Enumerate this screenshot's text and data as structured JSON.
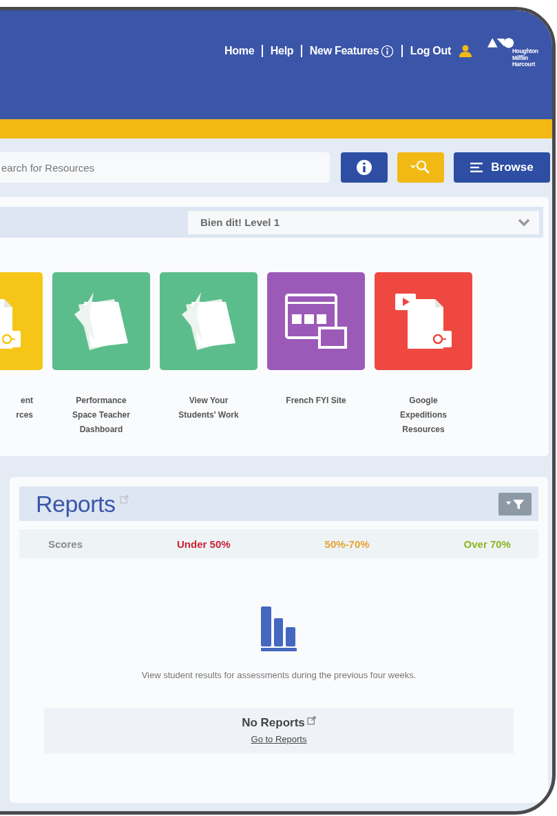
{
  "header": {
    "nav": [
      {
        "label": "Home",
        "kind": "plain"
      },
      {
        "label": "Help",
        "kind": "plain"
      },
      {
        "label": "New Features",
        "kind": "info"
      },
      {
        "label": "Log Out",
        "kind": "user"
      }
    ],
    "logo": {
      "lines": [
        "Houghton",
        "Mifflin",
        "Harcourt"
      ]
    }
  },
  "search": {
    "placeholder": "earch for Resources",
    "browse_label": "Browse"
  },
  "course_select": {
    "value": "Bien dit! Level 1"
  },
  "tiles": [
    {
      "lines": [
        "ent",
        "rces"
      ],
      "color": "#f5c518",
      "kind": "document"
    },
    {
      "lines": [
        "Performance",
        "Space Teacher",
        "Dashboard"
      ],
      "color": "#5cbd8c",
      "kind": "pages"
    },
    {
      "lines": [
        "View Your",
        "Students' Work"
      ],
      "color": "#5cbd8c",
      "kind": "pages"
    },
    {
      "lines": [
        "French FYI Site"
      ],
      "color": "#9b5ab8",
      "kind": "window"
    },
    {
      "lines": [
        "Google",
        "Expeditions",
        "Resources"
      ],
      "color": "#ee4840",
      "kind": "document"
    }
  ],
  "reports": {
    "title": "Reports",
    "scores": [
      {
        "label": "Scores",
        "color": "#8a8a8a"
      },
      {
        "label": "Under 50%",
        "color": "#cc2233"
      },
      {
        "label": "50%-70%",
        "color": "#e6a431"
      },
      {
        "label": "Over 70%",
        "color": "#8cb51e"
      }
    ],
    "description": "View student results for assessments during the previous four weeks.",
    "empty_title": "No Reports",
    "empty_link": "Go to Reports"
  }
}
